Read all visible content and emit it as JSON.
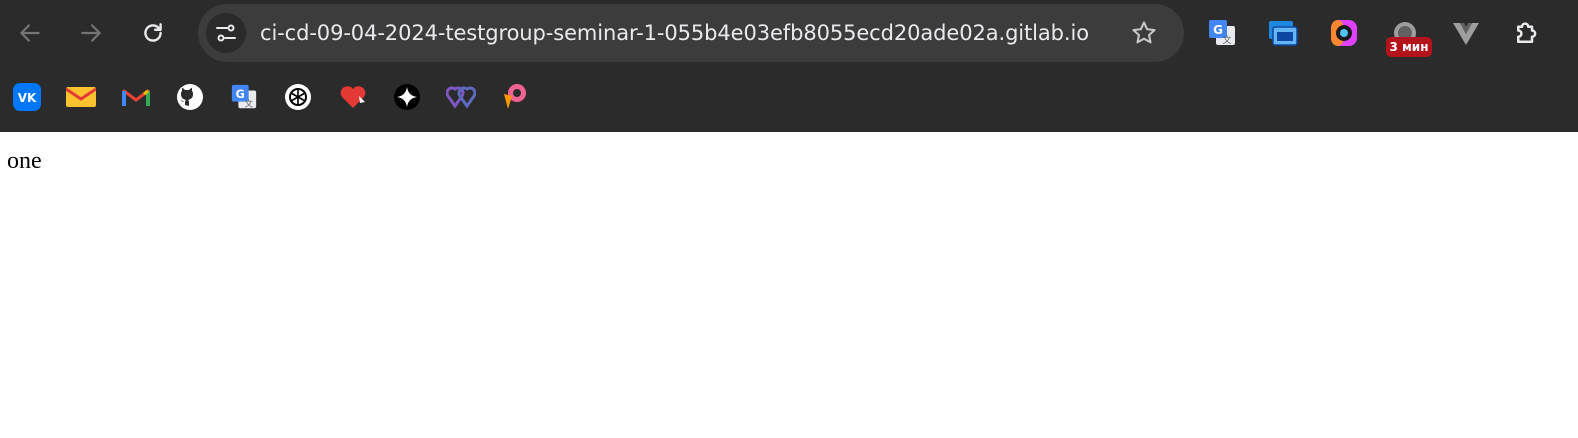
{
  "toolbar": {
    "back_icon": "arrow-left-icon",
    "forward_icon": "arrow-right-icon",
    "reload_icon": "reload-icon",
    "site_info_icon": "tune-icon",
    "url": "ci-cd-09-04-2024-testgroup-seminar-1-055b4e03efb8055ecd20ade02a.gitlab.io",
    "bookmark_star_icon": "star-outline-icon"
  },
  "extensions": [
    {
      "name": "google-translate-icon"
    },
    {
      "name": "screen-capture-icon"
    },
    {
      "name": "camera-lens-icon"
    },
    {
      "name": "timer-extension-icon",
      "badge": "3 мин"
    },
    {
      "name": "vue-devtools-icon"
    },
    {
      "name": "extensions-puzzle-icon"
    }
  ],
  "bookmarks": [
    {
      "name": "vk-icon"
    },
    {
      "name": "mail-icon"
    },
    {
      "name": "gmail-icon"
    },
    {
      "name": "github-icon"
    },
    {
      "name": "google-translate-icon"
    },
    {
      "name": "openai-icon"
    },
    {
      "name": "heart-icon"
    },
    {
      "name": "sparkle-icon"
    },
    {
      "name": "hearts-icon"
    },
    {
      "name": "pink-p-icon"
    }
  ],
  "page": {
    "text": "one"
  },
  "colors": {
    "toolbar_bg": "#2b2b2b",
    "omnibox_bg": "#3c3c3c",
    "badge_bg": "#b3131b"
  }
}
